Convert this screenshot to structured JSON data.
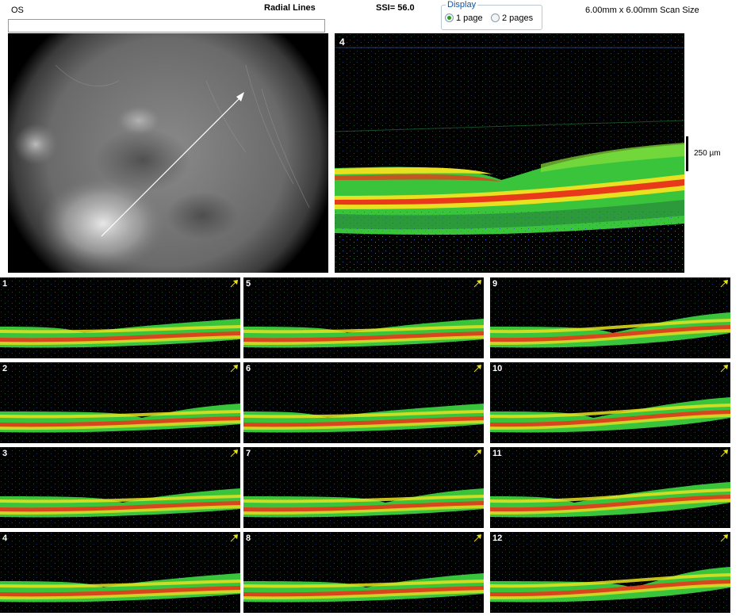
{
  "header": {
    "eye": "OS",
    "scan_pattern": "Radial Lines",
    "ssi": "SSI= 56.0",
    "scan_size": "6.00mm x 6.00mm Scan Size"
  },
  "display": {
    "legend": "Display",
    "options": [
      {
        "label": "1 page",
        "selected": true
      },
      {
        "label": "2 pages",
        "selected": false
      }
    ]
  },
  "main_scan": {
    "number": "4",
    "scale_label": "250 µm"
  },
  "thumbnails": [
    {
      "number": "1"
    },
    {
      "number": "5"
    },
    {
      "number": "9"
    },
    {
      "number": "2"
    },
    {
      "number": "6"
    },
    {
      "number": "10"
    },
    {
      "number": "3"
    },
    {
      "number": "7"
    },
    {
      "number": "11"
    },
    {
      "number": "4"
    },
    {
      "number": "8"
    },
    {
      "number": "12"
    }
  ],
  "colors": {
    "radio_selected": "#2c9a2c",
    "legend_text": "#0b54a6",
    "oct_green": "#39c43c",
    "oct_yellow": "#e8e020",
    "oct_red": "#e83a1a",
    "scan_arrow": "#ffffff",
    "thumb_arrow": "#e8e020"
  }
}
